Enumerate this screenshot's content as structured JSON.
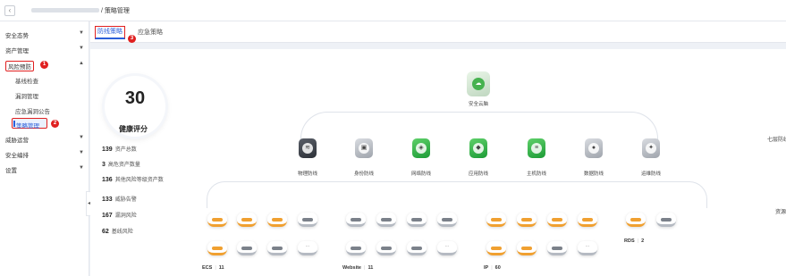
{
  "header": {
    "back_icon": "chevron-left-icon",
    "breadcrumb_current": "策略管理"
  },
  "sidebar": {
    "items": [
      {
        "label": "安全态势",
        "caret": "▼"
      },
      {
        "label": "资产管理",
        "caret": "▼"
      },
      {
        "label": "风险预防",
        "caret": "▲",
        "badge": "1"
      },
      {
        "label": "基线检查"
      },
      {
        "label": "漏洞管理"
      },
      {
        "label": "应急漏洞公告"
      },
      {
        "label": "策略管理",
        "badge": "2"
      },
      {
        "label": "威胁运营",
        "caret": "▼"
      },
      {
        "label": "安全编排",
        "caret": "▼"
      },
      {
        "label": "设置",
        "caret": "▼"
      }
    ],
    "collapse_icon": "◀"
  },
  "tabs": [
    {
      "label": "防线策略",
      "badge": "3"
    },
    {
      "label": "应急策略"
    }
  ],
  "score_panel": {
    "score": "30",
    "score_label": "健康评分",
    "stats": [
      {
        "value": "139",
        "label": "资产总数"
      },
      {
        "value": "3",
        "label": "高危资产数量"
      },
      {
        "value": "136",
        "label": "其他风险等级资产数"
      },
      {
        "value": "133",
        "label": "威胁告警"
      },
      {
        "value": "167",
        "label": "漏洞风险"
      },
      {
        "value": "62",
        "label": "基线风险"
      }
    ]
  },
  "topology": {
    "root": {
      "label": "安全云脑",
      "icon": "security-brain-icon"
    },
    "defense_lines": [
      {
        "label": "物理防线",
        "color": "dark",
        "icon": "layers-icon"
      },
      {
        "label": "身份防线",
        "color": "gray",
        "icon": "id-card-icon"
      },
      {
        "label": "网络防线",
        "color": "green",
        "icon": "network-icon"
      },
      {
        "label": "应用防线",
        "color": "green",
        "icon": "app-icon"
      },
      {
        "label": "主机防线",
        "color": "green",
        "icon": "host-icon"
      },
      {
        "label": "数据防线",
        "color": "gray",
        "icon": "data-icon"
      },
      {
        "label": "运维防线",
        "color": "gray",
        "icon": "ops-icon"
      }
    ],
    "right_labels": [
      "七层防线",
      "资源"
    ],
    "asset_groups": [
      {
        "name": "ECS",
        "count": "11"
      },
      {
        "name": "Website",
        "count": "11"
      },
      {
        "name": "IP",
        "count": "60"
      },
      {
        "name": "RDS",
        "count": "2"
      }
    ]
  }
}
